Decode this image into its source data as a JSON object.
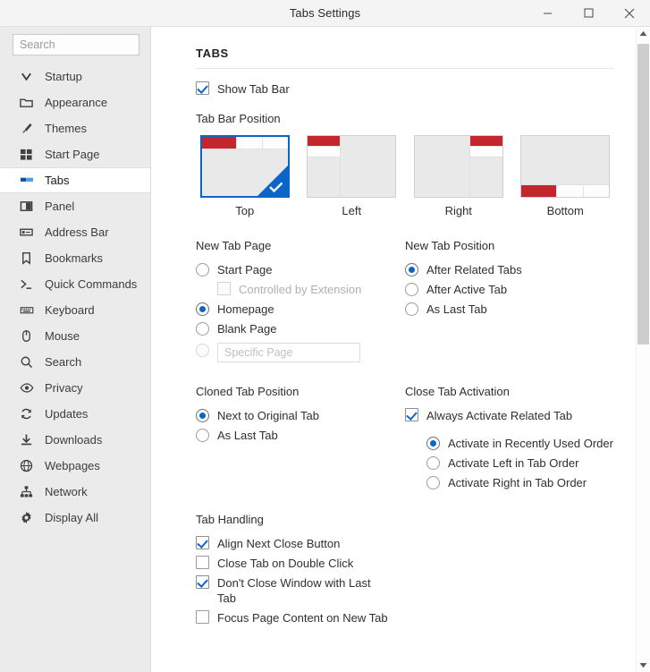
{
  "window": {
    "title": "Tabs Settings",
    "minimize_label": "Minimize",
    "maximize_label": "Maximize",
    "close_label": "Close"
  },
  "sidebar": {
    "search": {
      "placeholder": "Search",
      "value": ""
    },
    "items": [
      {
        "label": "Startup",
        "icon": "chevron-down-icon",
        "selected": false
      },
      {
        "label": "Appearance",
        "icon": "folder-icon",
        "selected": false
      },
      {
        "label": "Themes",
        "icon": "brush-icon",
        "selected": false
      },
      {
        "label": "Start Page",
        "icon": "grid-icon",
        "selected": false
      },
      {
        "label": "Tabs",
        "icon": "tabs-icon",
        "selected": true
      },
      {
        "label": "Panel",
        "icon": "panel-icon",
        "selected": false
      },
      {
        "label": "Address Bar",
        "icon": "address-bar-icon",
        "selected": false
      },
      {
        "label": "Bookmarks",
        "icon": "bookmark-icon",
        "selected": false
      },
      {
        "label": "Quick Commands",
        "icon": "terminal-icon",
        "selected": false
      },
      {
        "label": "Keyboard",
        "icon": "keyboard-icon",
        "selected": false
      },
      {
        "label": "Mouse",
        "icon": "mouse-icon",
        "selected": false
      },
      {
        "label": "Search",
        "icon": "search-icon",
        "selected": false
      },
      {
        "label": "Privacy",
        "icon": "eye-icon",
        "selected": false
      },
      {
        "label": "Updates",
        "icon": "refresh-icon",
        "selected": false
      },
      {
        "label": "Downloads",
        "icon": "download-icon",
        "selected": false
      },
      {
        "label": "Webpages",
        "icon": "globe-icon",
        "selected": false
      },
      {
        "label": "Network",
        "icon": "network-icon",
        "selected": false
      },
      {
        "label": "Display All",
        "icon": "gear-icon",
        "selected": false
      }
    ]
  },
  "main": {
    "section_title": "TABS",
    "show_tab_bar": {
      "label": "Show Tab Bar",
      "checked": true
    },
    "tab_bar_position": {
      "label": "Tab Bar Position",
      "selected": "Top",
      "options": [
        {
          "label": "Top",
          "selected": true
        },
        {
          "label": "Left",
          "selected": false
        },
        {
          "label": "Right",
          "selected": false
        },
        {
          "label": "Bottom",
          "selected": false
        }
      ]
    },
    "new_tab_page": {
      "label": "New Tab Page",
      "options": [
        {
          "label": "Start Page",
          "type": "radio",
          "checked": false,
          "disabled": false,
          "indent": 0
        },
        {
          "label": "Controlled by Extension",
          "type": "checkbox",
          "checked": false,
          "disabled": true,
          "indent": 1
        },
        {
          "label": "Homepage",
          "type": "radio",
          "checked": true,
          "disabled": false,
          "indent": 0
        },
        {
          "label": "Blank Page",
          "type": "radio",
          "checked": false,
          "disabled": false,
          "indent": 0
        }
      ],
      "specific_page": {
        "radio_checked": false,
        "radio_disabled": true,
        "placeholder": "Specific Page",
        "value": ""
      }
    },
    "new_tab_position": {
      "label": "New Tab Position",
      "options": [
        {
          "label": "After Related Tabs",
          "checked": true
        },
        {
          "label": "After Active Tab",
          "checked": false
        },
        {
          "label": "As Last Tab",
          "checked": false
        }
      ]
    },
    "cloned_tab_position": {
      "label": "Cloned Tab Position",
      "options": [
        {
          "label": "Next to Original Tab",
          "checked": true
        },
        {
          "label": "As Last Tab",
          "checked": false
        }
      ]
    },
    "close_tab_activation": {
      "label": "Close Tab Activation",
      "always_activate": {
        "label": "Always Activate Related Tab",
        "checked": true
      },
      "options": [
        {
          "label": "Activate in Recently Used Order",
          "checked": true
        },
        {
          "label": "Activate Left in Tab Order",
          "checked": false
        },
        {
          "label": "Activate Right in Tab Order",
          "checked": false
        }
      ]
    },
    "tab_handling": {
      "label": "Tab Handling",
      "options": [
        {
          "label": "Align Next Close Button",
          "checked": true
        },
        {
          "label": "Close Tab on Double Click",
          "checked": false
        },
        {
          "label": "Don't Close Window with Last Tab",
          "checked": true
        },
        {
          "label": "Focus Page Content on New Tab",
          "checked": false
        }
      ]
    }
  },
  "colors": {
    "accent": "#0b65c8",
    "tab_red": "#c4262e",
    "sidebar_bg": "#ebebeb",
    "titlebar_bg": "#f4f4f4"
  }
}
